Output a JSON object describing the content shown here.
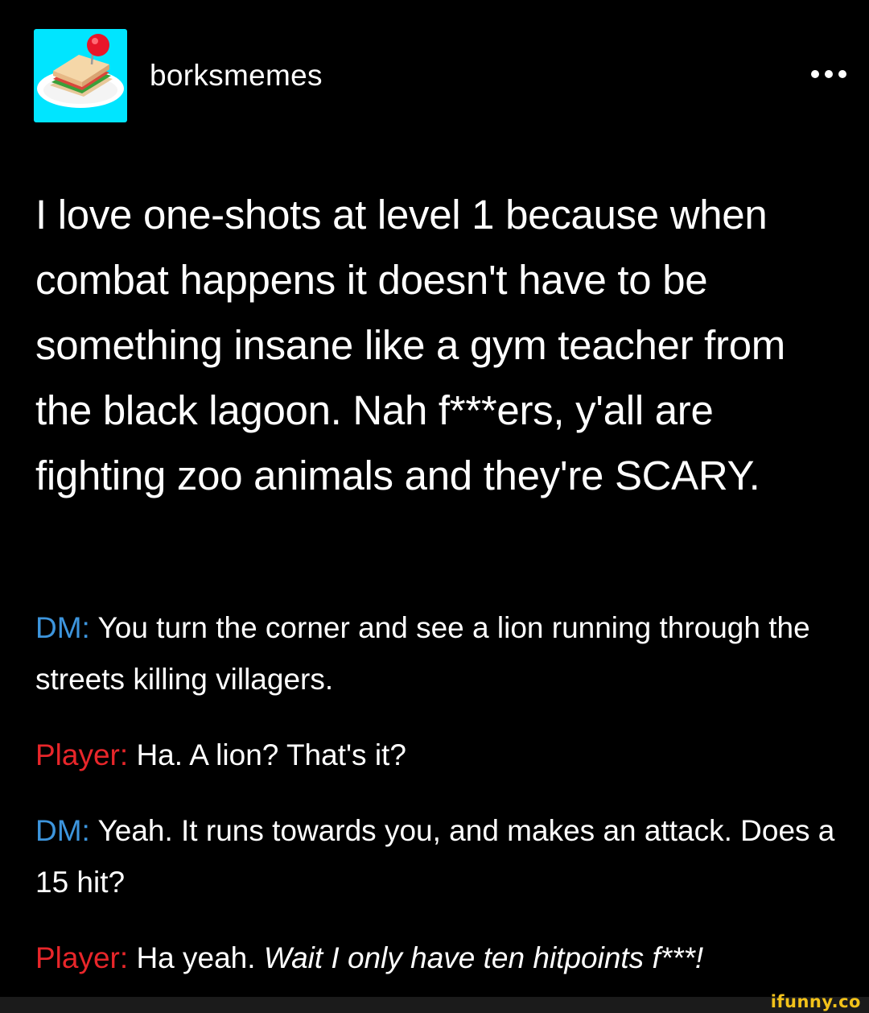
{
  "post": {
    "username": "borksmemes",
    "more_icon": "ellipsis-icon",
    "avatar_icon": "sandwich-plate-icon",
    "avatar_bg": "#00e5ff",
    "title": "I love one-shots at level 1 because when combat happens it doesn't have to be something insane like a gym teacher from the black lagoon. Nah f***ers, y'all are fighting zoo animals and they're SCARY.",
    "dialogue": [
      {
        "speaker": "DM:",
        "text": "You turn the corner and see a lion running through the streets killing villagers."
      },
      {
        "speaker": "Player:",
        "text": "Ha. A lion? That's it?"
      },
      {
        "speaker": "DM:",
        "text": "Yeah. It runs towards you, and makes an attack. Does a 15 hit?"
      },
      {
        "speaker": "Player:",
        "text": "Ha yeah.",
        "italic": "Wait I only have ten hitpoints f***!"
      }
    ]
  },
  "colors": {
    "background": "#000000",
    "text": "#ffffff",
    "dm": "#3d95dd",
    "player": "#e8262a",
    "watermark": "#f2c21a"
  },
  "watermark": "ifunny.co"
}
